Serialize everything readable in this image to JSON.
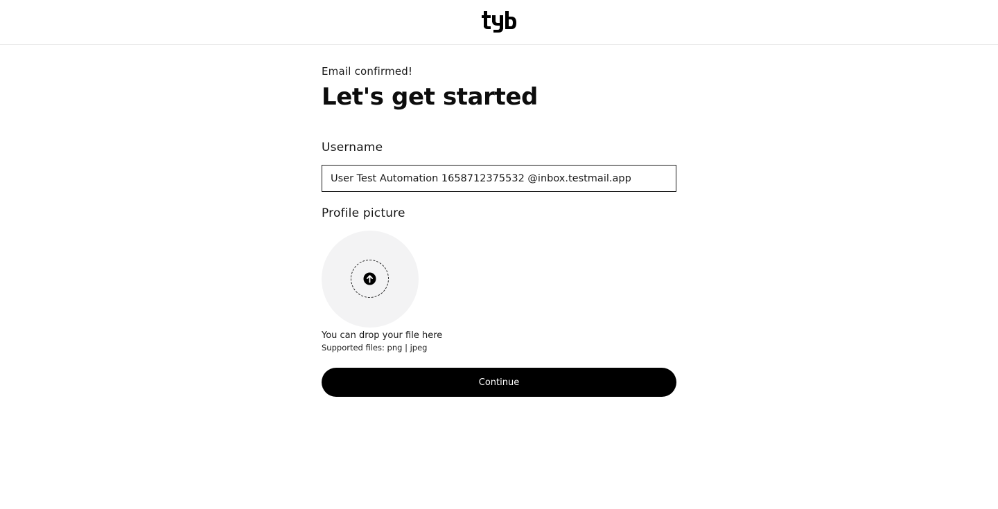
{
  "header": {
    "logo_text": "tyb"
  },
  "signup": {
    "subtitle": "Email confirmed!",
    "title": "Let's get started",
    "username_label": "Username",
    "username_value": "User Test Automation 1658712375532 @inbox.testmail.app",
    "picture_label": "Profile picture",
    "drop_hint": "You can drop your file here",
    "supported_files": "Supported files: png | jpeg",
    "continue_label": "Continue"
  },
  "icons": {
    "logo": "tyb-logo",
    "upload": "arrow-up-circle-icon"
  },
  "colors": {
    "primary": "#000000",
    "avatar_bg": "#f3f3f4",
    "divider": "#e6e6e6"
  }
}
